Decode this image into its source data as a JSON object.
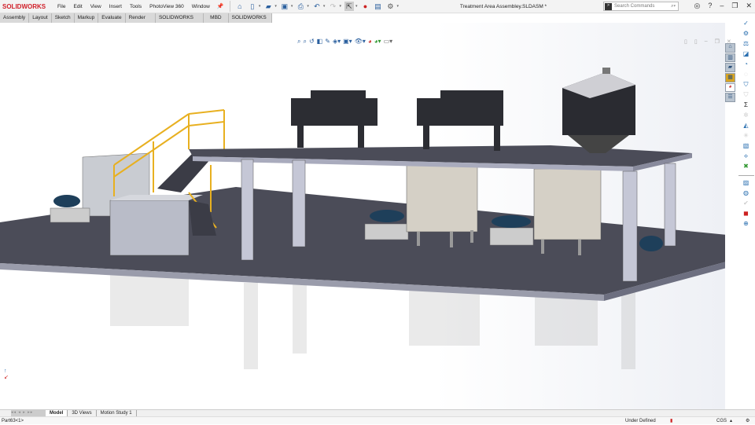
{
  "app": {
    "logo": "SOLIDWORKS",
    "title": "Treatment Area Assembley.SLDASM *"
  },
  "menu": [
    "File",
    "Edit",
    "View",
    "Insert",
    "Tools",
    "PhotoView 360",
    "Window"
  ],
  "search": {
    "placeholder": "Search Commands"
  },
  "command_tabs": [
    "Assembly",
    "Layout",
    "Sketch",
    "Markup",
    "Evaluate",
    "Render Tools",
    "SOLIDWORKS Add-Ins",
    "MBD",
    "SOLIDWORKS CAM"
  ],
  "bottom_tabs": [
    "Model",
    "3D Views",
    "Motion Study 1"
  ],
  "status": {
    "left": "Part63<1>",
    "state": "Under Defined",
    "units": "CGS"
  },
  "colors": {
    "accent": "#d0202a",
    "floor": "#4b4c58",
    "railing": "#e8b020"
  }
}
